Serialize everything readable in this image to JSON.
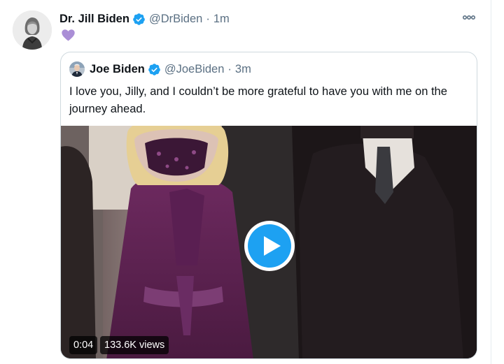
{
  "tweet": {
    "author_name": "Dr. Jill Biden",
    "author_handle": "@DrBiden",
    "separator": "·",
    "time": "1m",
    "content_emoji": "purple-heart-icon",
    "more_icon": "more-options-icon"
  },
  "quoted": {
    "author_name": "Joe Biden",
    "author_handle": "@JoeBiden",
    "separator": "·",
    "time": "3m",
    "text": "I love you, Jilly, and I couldn’t be more grateful to have you with me on the journey ahead.",
    "video": {
      "duration": "0:04",
      "views": "133.6K views",
      "play_icon": "play-icon"
    }
  },
  "colors": {
    "verified_blue": "#1da1f2",
    "muted_text": "#5b7083",
    "heart_purple": "#aa8ed6",
    "border": "#cfd9de"
  }
}
